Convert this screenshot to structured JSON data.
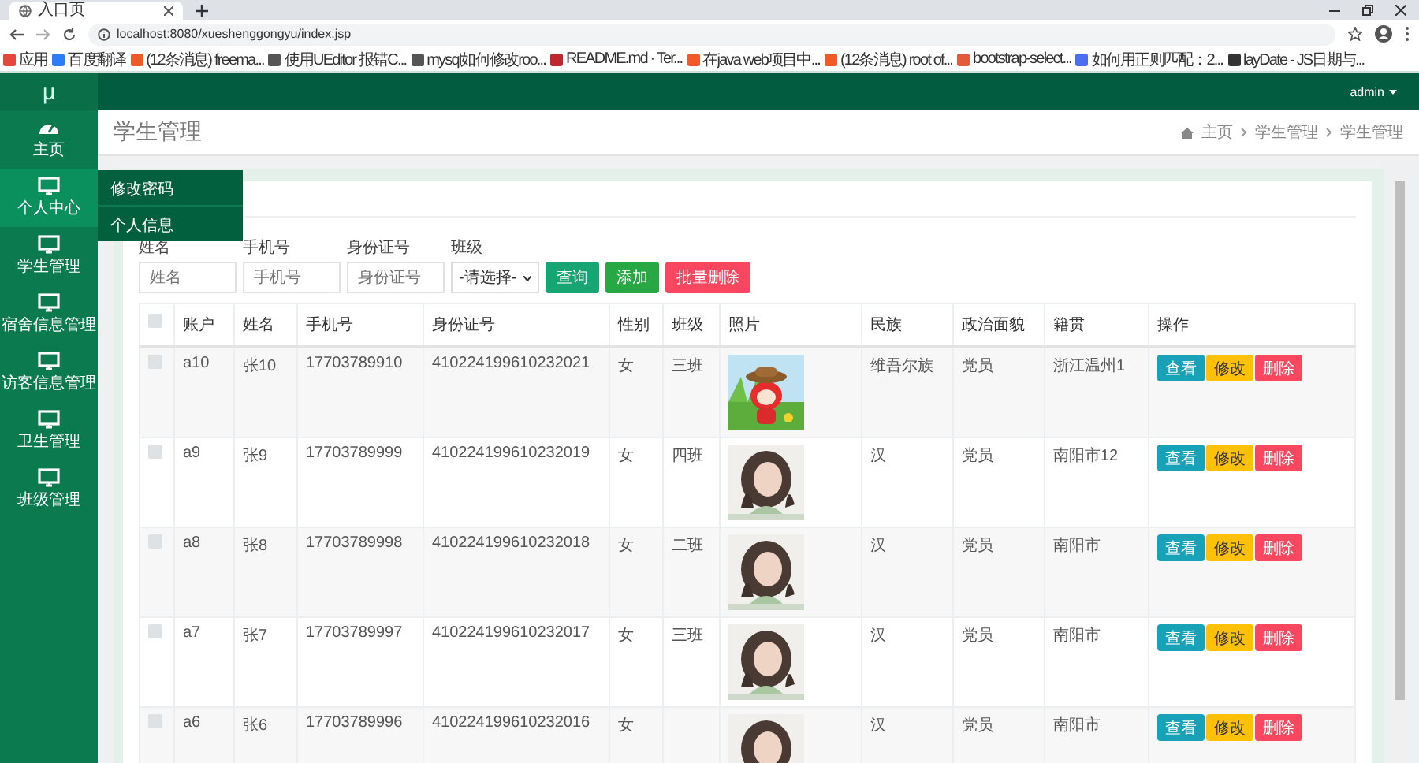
{
  "browser": {
    "tab_title": "入口页",
    "url": "localhost:8080/xueshenggongyu/index.jsp",
    "bookmarks": [
      {
        "label": "应用",
        "color": "#e8453c"
      },
      {
        "label": "百度翻译",
        "color": "#2f7df6"
      },
      {
        "label": "(12条消息) freema...",
        "color": "#f05a28"
      },
      {
        "label": "使用UEditor 报错C...",
        "color": "#555555"
      },
      {
        "label": "mysql如何修改roo...",
        "color": "#555555"
      },
      {
        "label": "README.md · Ter...",
        "color": "#c0282f"
      },
      {
        "label": "在java web项目中...",
        "color": "#f05a28"
      },
      {
        "label": "(12条消息) root of...",
        "color": "#f05a28"
      },
      {
        "label": "bootstrap-select...",
        "color": "#e45a3c"
      },
      {
        "label": "如何用正则匹配：2...",
        "color": "#4e6ef2"
      },
      {
        "label": "layDate - JS日期与...",
        "color": "#333333"
      }
    ]
  },
  "sidebar": {
    "logo": "μ",
    "items": [
      {
        "label": "主页",
        "kind": "dashboard"
      },
      {
        "label": "个人中心",
        "kind": "monitor",
        "expanded": true,
        "submenu": [
          "修改密码",
          "个人信息"
        ]
      },
      {
        "label": "学生管理",
        "kind": "monitor",
        "expanded": false
      },
      {
        "label": "宿舍信息管理",
        "kind": "monitor",
        "expanded": false
      },
      {
        "label": "访客信息管理",
        "kind": "monitor",
        "expanded": false
      },
      {
        "label": "卫生管理",
        "kind": "monitor",
        "expanded": false
      },
      {
        "label": "班级管理",
        "kind": "monitor",
        "expanded": false
      }
    ]
  },
  "topbar": {
    "user": "admin"
  },
  "page": {
    "title": "学生管理",
    "breadcrumb": [
      "主页",
      "学生管理",
      "学生管理"
    ]
  },
  "search": {
    "fields": [
      {
        "label": "姓名",
        "placeholder": "姓名",
        "kind": "input"
      },
      {
        "label": "手机号",
        "placeholder": "手机号",
        "kind": "input"
      },
      {
        "label": "身份证号",
        "placeholder": "身份证号",
        "kind": "input"
      },
      {
        "label": "班级",
        "value": "-请选择-",
        "kind": "select"
      }
    ],
    "buttons": [
      {
        "label": "查询",
        "kind": "primary"
      },
      {
        "label": "添加",
        "kind": "success"
      },
      {
        "label": "批量删除",
        "kind": "danger"
      }
    ]
  },
  "table": {
    "header_checked": false,
    "columns": [
      "账户",
      "姓名",
      "手机号",
      "身份证号",
      "性别",
      "班级",
      "照片",
      "民族",
      "政治面貌",
      "籍贯",
      "操作"
    ],
    "rows": [
      {
        "checked": false,
        "cells": [
          "a10",
          "张10",
          "17703789910",
          "410224199610232021",
          "女",
          "三班",
          "",
          "维吾尔族",
          "党员",
          "浙江温州1"
        ],
        "actions": [
          {
            "label": "查看",
            "kind": "info"
          },
          {
            "label": "修改",
            "kind": "warning"
          },
          {
            "label": "删除",
            "kind": "danger"
          }
        ]
      },
      {
        "checked": false,
        "cells": [
          "a9",
          "张9",
          "17703789999",
          "410224199610232019",
          "女",
          "四班",
          "",
          "汉",
          "党员",
          "南阳市12"
        ],
        "actions": [
          {
            "label": "查看",
            "kind": "info"
          },
          {
            "label": "修改",
            "kind": "warning"
          },
          {
            "label": "删除",
            "kind": "danger"
          }
        ]
      },
      {
        "checked": false,
        "cells": [
          "a8",
          "张8",
          "17703789998",
          "410224199610232018",
          "女",
          "二班",
          "",
          "汉",
          "党员",
          "南阳市"
        ],
        "actions": [
          {
            "label": "查看",
            "kind": "info"
          },
          {
            "label": "修改",
            "kind": "warning"
          },
          {
            "label": "删除",
            "kind": "danger"
          }
        ]
      },
      {
        "checked": false,
        "cells": [
          "a7",
          "张7",
          "17703789997",
          "410224199610232017",
          "女",
          "三班",
          "",
          "汉",
          "党员",
          "南阳市"
        ],
        "actions": [
          {
            "label": "查看",
            "kind": "info"
          },
          {
            "label": "修改",
            "kind": "warning"
          },
          {
            "label": "删除",
            "kind": "danger"
          }
        ]
      },
      {
        "checked": false,
        "cells": [
          "a6",
          "张6",
          "17703789996",
          "410224199610232016",
          "女",
          "",
          "",
          "汉",
          "党员",
          "南阳市"
        ],
        "actions": [
          {
            "label": "查看",
            "kind": "info"
          },
          {
            "label": "修改",
            "kind": "warning"
          },
          {
            "label": "删除",
            "kind": "danger"
          }
        ]
      }
    ]
  }
}
